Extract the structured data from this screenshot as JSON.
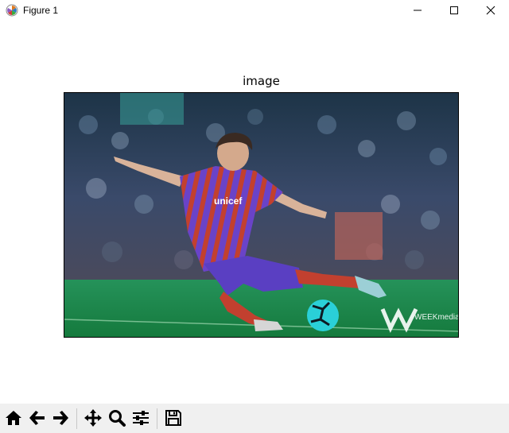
{
  "window": {
    "title": "Figure 1",
    "controls": {
      "minimize": "minimize-icon",
      "maximize": "maximize-icon",
      "close": "close-icon"
    }
  },
  "figure": {
    "title": "image",
    "image": {
      "content": "photo-of-soccer-player-kicking-ball",
      "shirt_text": "unicef",
      "watermark": "WEEKmedia"
    }
  },
  "toolbar": {
    "buttons": [
      {
        "icon": "home-icon"
      },
      {
        "icon": "back-arrow-icon"
      },
      {
        "icon": "forward-arrow-icon"
      },
      {
        "icon": "pan-icon"
      },
      {
        "icon": "zoom-icon"
      },
      {
        "icon": "configure-subplots-icon"
      },
      {
        "icon": "save-icon"
      }
    ]
  },
  "colors": {
    "pitch_green": "#1f8a4a",
    "shirt_purple": "#5b3fc2",
    "shirt_red": "#c1302a",
    "ball_cyan": "#2ad0d8"
  }
}
